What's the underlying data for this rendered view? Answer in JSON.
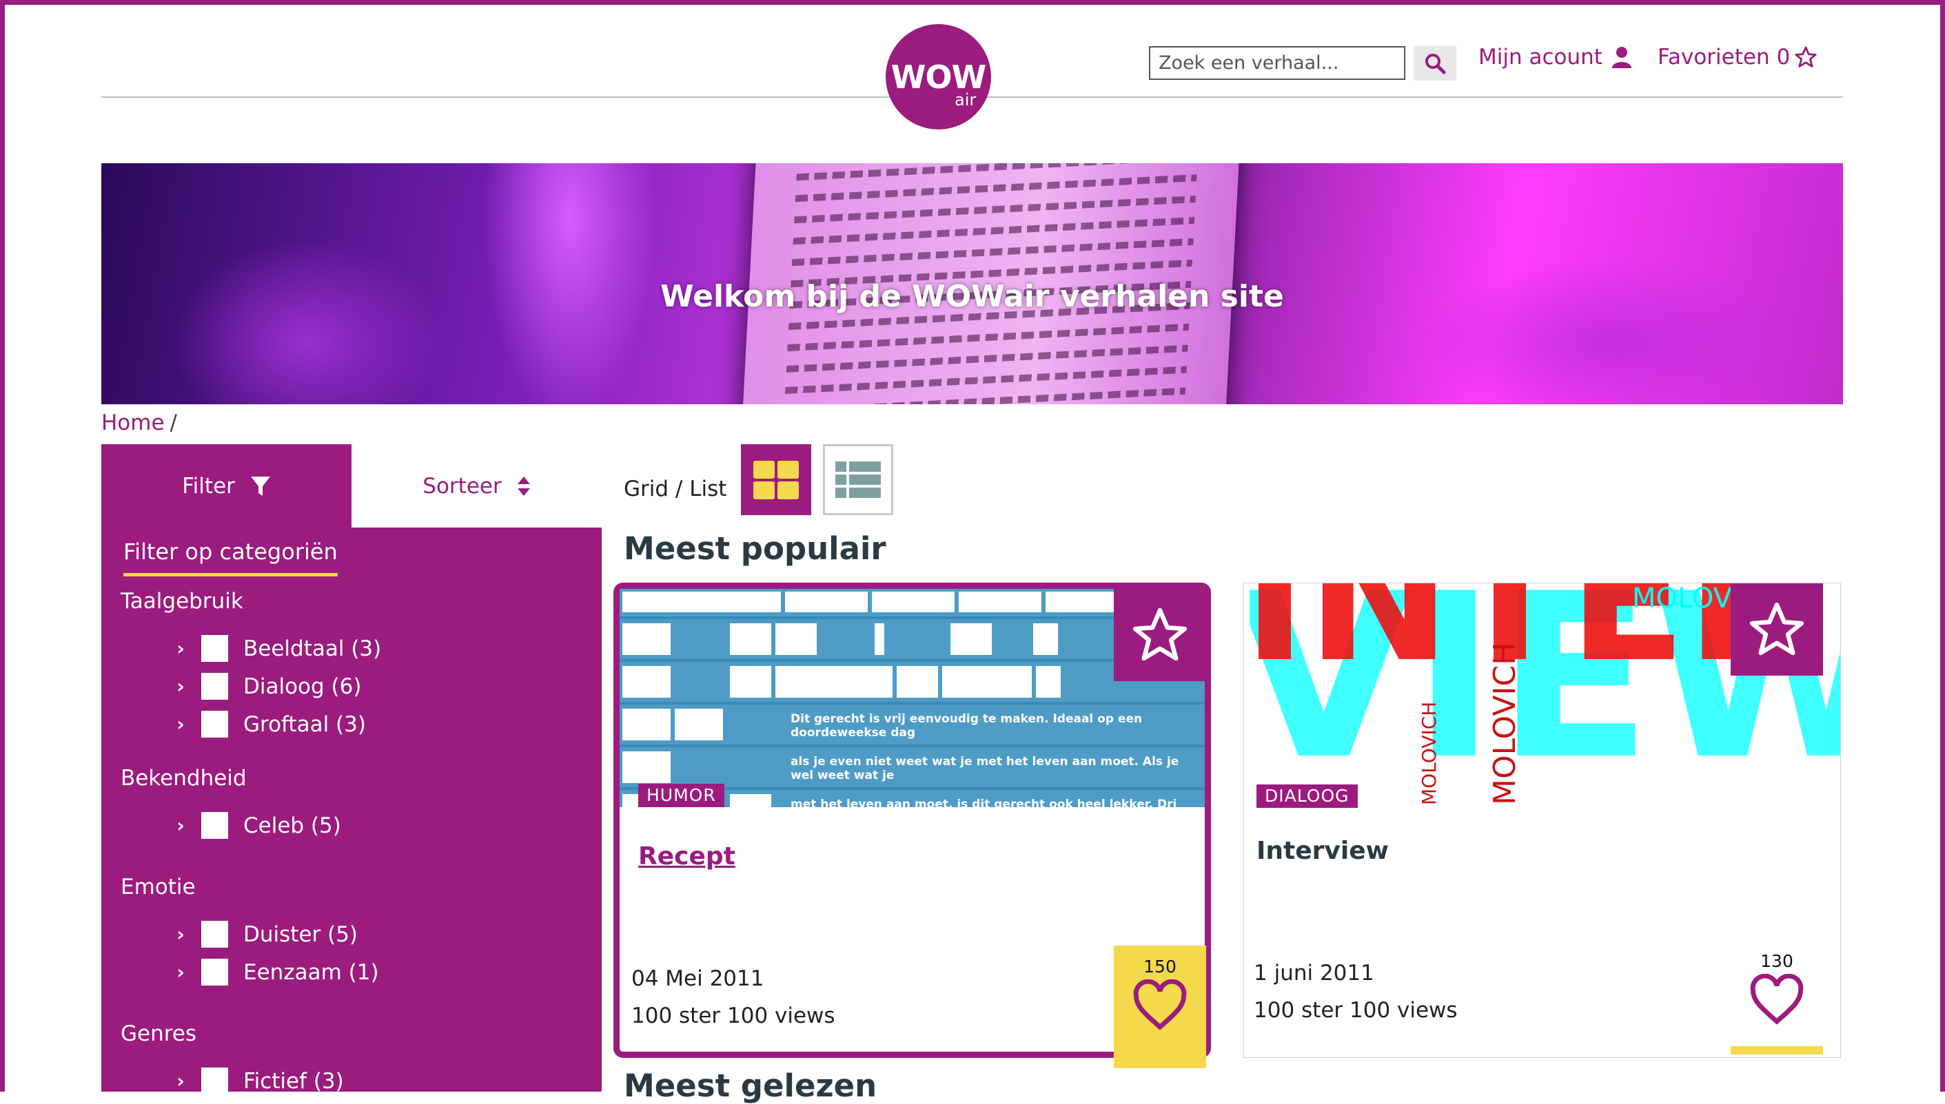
{
  "header": {
    "logo_main": "WOW",
    "logo_sub": "air",
    "search_placeholder": "Zoek een verhaal...",
    "account_label": "Mijn acount",
    "favorites_label": "Favorieten",
    "favorites_count": "0"
  },
  "hero": {
    "title": "Welkom bij de WOWair verhalen site"
  },
  "breadcrumb": {
    "home": "Home",
    "separator": "/"
  },
  "sidebar": {
    "filter_tab": "Filter",
    "sort_tab": "Sorteer",
    "category_title": "Filter op categoriën",
    "groups": [
      {
        "title": "Taalgebruik",
        "items": [
          "Beeldtaal (3)",
          "Dialoog (6)",
          "Groftaal (3)"
        ]
      },
      {
        "title": "Bekendheid",
        "items": [
          "Celeb (5)"
        ]
      },
      {
        "title": "Emotie",
        "items": [
          "Duister (5)",
          "Eenzaam (1)"
        ]
      },
      {
        "title": "Genres",
        "items": [
          "Fictief (3)"
        ]
      }
    ]
  },
  "view": {
    "label": "Grid / List"
  },
  "sections": {
    "popular": "Meest populair",
    "most_read": "Meest gelezen"
  },
  "cards": [
    {
      "tag": "HUMOR",
      "title": "Recept",
      "date": "04 Mei 2011",
      "stats": "100 ster 100 views",
      "likes": "150",
      "image_text": [
        "Dit gerecht is vrij eenvoudig te maken. Ideaal op een doordeweekse dag",
        "als je even niet weet wat je met het leven aan moet. Als je wel weet wat je",
        "met het leven aan moet, is dit gerecht ook heel lekker. Drinksuggestie: een"
      ]
    },
    {
      "tag": "DIALOOG",
      "title": "Interview",
      "date": "1 juni 2011",
      "stats": "100 ster 100 views",
      "likes": "130",
      "image_text": [
        "INTER",
        "VIEW",
        "MOLOV",
        "MOLOVICH",
        "MOLOVICH"
      ]
    }
  ],
  "colors": {
    "brand": "#9b1b7e",
    "accent": "#f5d94c",
    "text_dark": "#2b3a42"
  }
}
